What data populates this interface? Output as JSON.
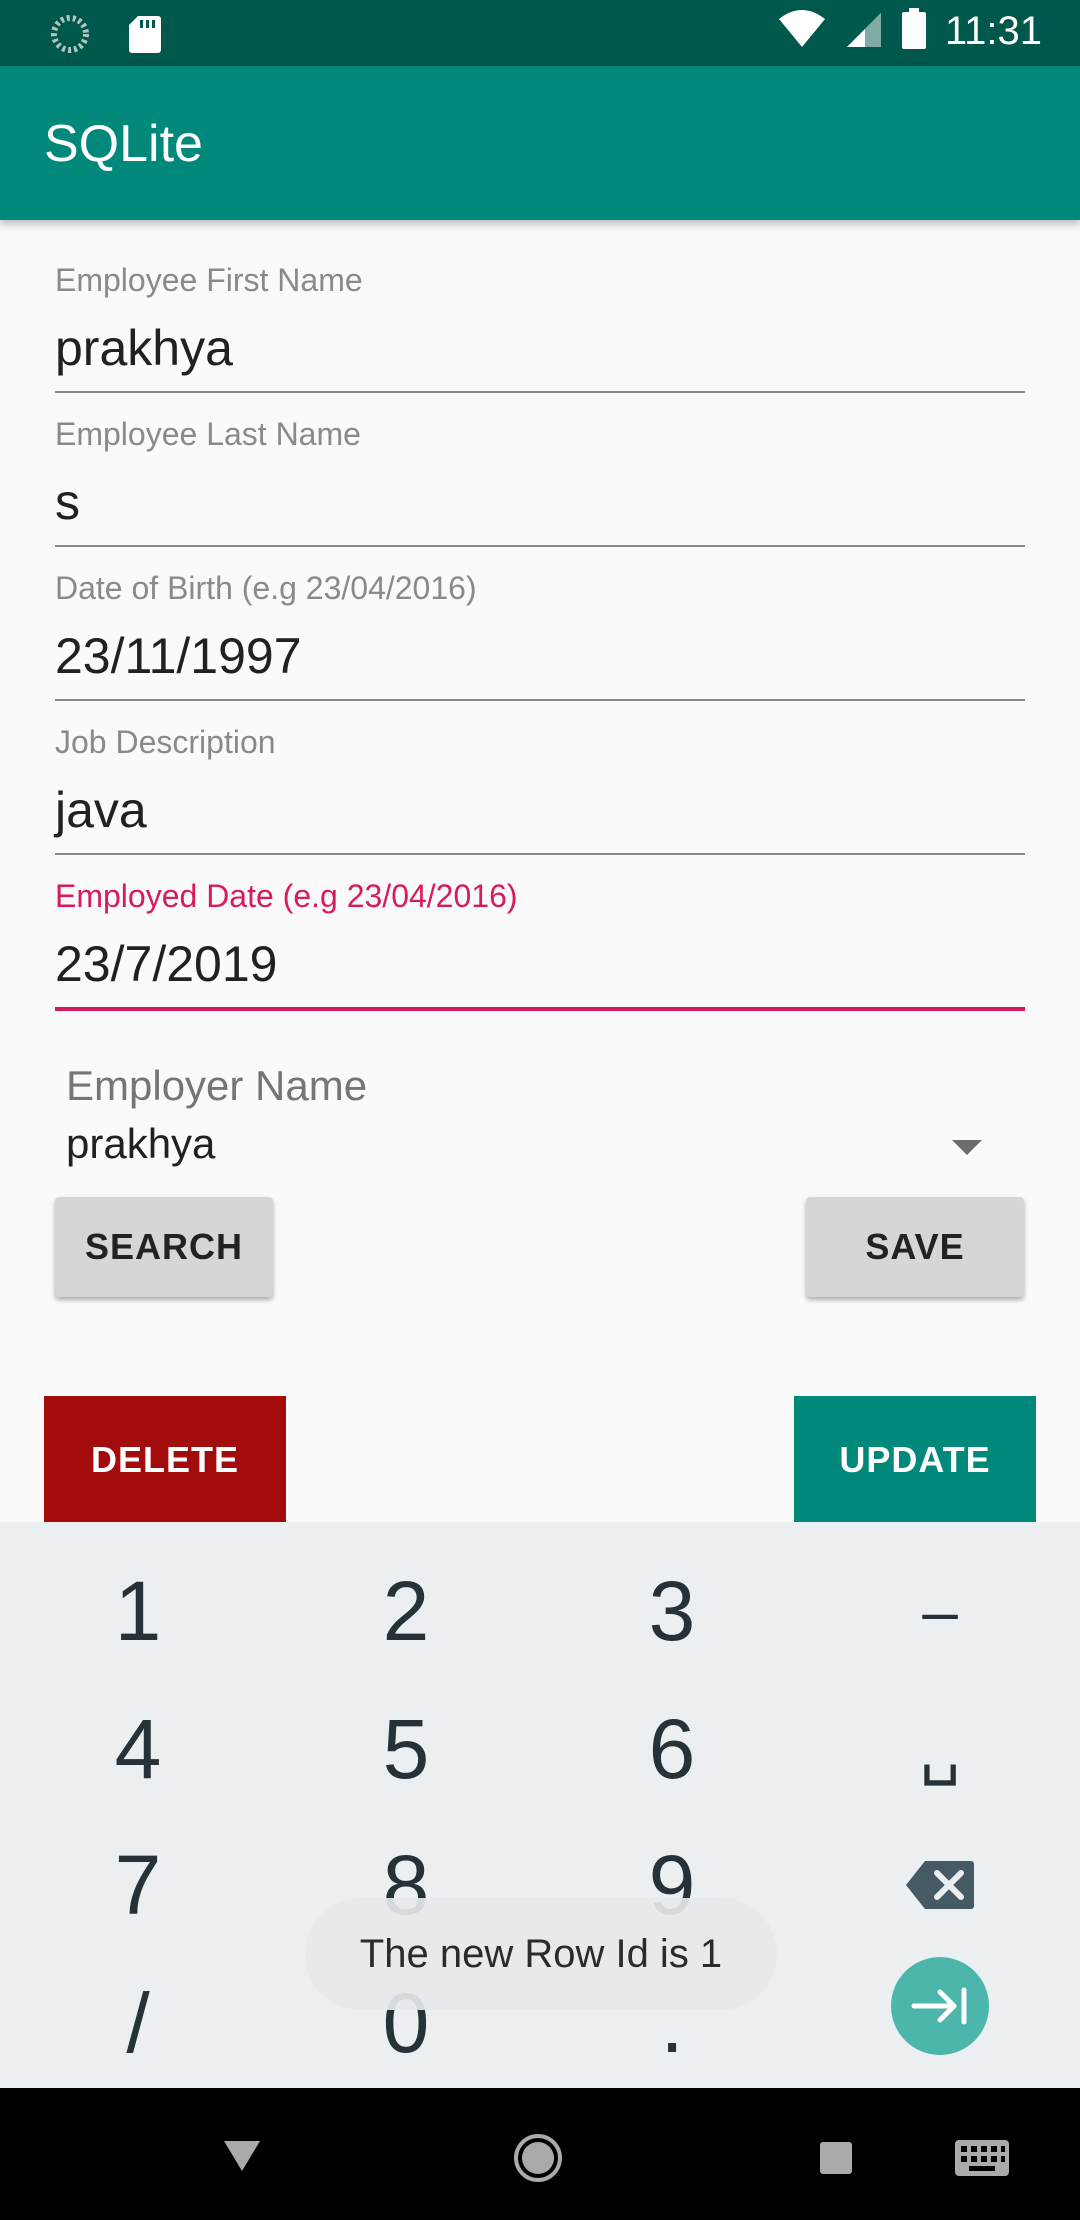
{
  "status_bar": {
    "time": "11:31",
    "icons": [
      "sync-icon",
      "sd-card-icon",
      "wifi-icon",
      "signal-icon",
      "battery-icon"
    ]
  },
  "app_bar": {
    "title": "SQLite"
  },
  "form": {
    "first_name": {
      "label": "Employee First Name",
      "value": "prakhya"
    },
    "last_name": {
      "label": "Employee Last Name",
      "value": "s"
    },
    "dob": {
      "label": "Date of Birth (e.g 23/04/2016)",
      "value": "23/11/1997"
    },
    "job": {
      "label": "Job Description",
      "value": "java"
    },
    "employed_date": {
      "label": "Employed Date (e.g 23/04/2016)",
      "value": "23/7/2019"
    },
    "employer": {
      "label": "Employer Name",
      "value": "prakhya"
    }
  },
  "buttons": {
    "search": "SEARCH",
    "save": "SAVE",
    "delete": "DELETE",
    "update": "UPDATE"
  },
  "keyboard": {
    "keys": [
      "1",
      "2",
      "3",
      "–",
      "4",
      "5",
      "6",
      "␣",
      "7",
      "8",
      "9",
      "/",
      "0",
      "."
    ]
  },
  "toast": {
    "text": "The new Row Id is 1"
  },
  "colors": {
    "primary": "#00897b",
    "primary_dark": "#00574b",
    "accent": "#d81b60",
    "delete": "#a20c0c"
  }
}
